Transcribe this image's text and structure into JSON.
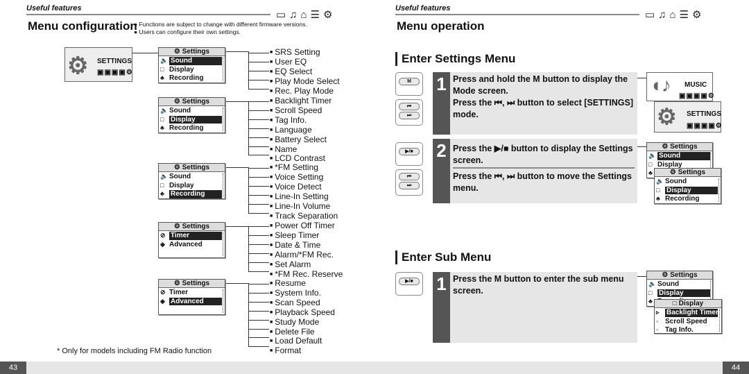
{
  "left": {
    "section": "Useful features",
    "title": "Menu configuration",
    "notes": [
      "Functions are subject to change with different firmware versions.",
      "Users can configure their own settings."
    ],
    "mode_label": "SETTINGS",
    "menus": [
      {
        "title": "Settings",
        "rows": [
          {
            "icon": "speaker",
            "label": "Sound"
          },
          {
            "icon": "display",
            "label": "Display"
          },
          {
            "icon": "mic",
            "label": "Recording"
          }
        ],
        "selected": 0,
        "items": [
          "SRS Setting",
          "User EQ",
          "EQ Select",
          "Play Mode Select",
          "Rec. Play Mode"
        ]
      },
      {
        "title": "Settings",
        "rows": [
          {
            "icon": "speaker",
            "label": "Sound"
          },
          {
            "icon": "display",
            "label": "Display"
          },
          {
            "icon": "mic",
            "label": "Recording"
          }
        ],
        "selected": 1,
        "items": [
          "Backlight Timer",
          "Scroll Speed",
          "Tag Info.",
          "Language",
          "Battery Select",
          "Name",
          "LCD Contrast"
        ]
      },
      {
        "title": "Settings",
        "rows": [
          {
            "icon": "speaker",
            "label": "Sound"
          },
          {
            "icon": "display",
            "label": "Display"
          },
          {
            "icon": "mic",
            "label": "Recording"
          }
        ],
        "selected": 2,
        "items": [
          "*FM Setting",
          "Voice Setting",
          "Voice Detect",
          "Line-In Setting",
          "Line-In Volume",
          "Track Separation"
        ]
      },
      {
        "title": "Settings",
        "rows": [
          {
            "icon": "timer",
            "label": "Timer"
          },
          {
            "icon": "advanced",
            "label": "Advanced"
          }
        ],
        "selected": 0,
        "items": [
          "Power Off Timer",
          "Sleep Timer",
          "Date & Time",
          "Alarm/*FM Rec.",
          "Set Alarm",
          "*FM Rec. Reserve"
        ]
      },
      {
        "title": "Settings",
        "rows": [
          {
            "icon": "timer",
            "label": "Timer"
          },
          {
            "icon": "advanced",
            "label": "Advanced"
          }
        ],
        "selected": 1,
        "items": [
          "Resume",
          "System Info.",
          "Scan Speed",
          "Playback Speed",
          "Study Mode",
          "Delete File",
          "Load Default",
          "Format"
        ]
      }
    ],
    "footnote": "* Only for models including FM Radio function",
    "page": "43"
  },
  "right": {
    "section": "Useful features",
    "title": "Menu operation",
    "enter_settings": "Enter Settings Menu",
    "step1_num": "1",
    "step1_a": "Press and hold the M button to display the Mode screen.",
    "step1_b": "Press the ⏮, ⏭ button to select [SETTINGS] mode.",
    "step2_num": "2",
    "step2_a": "Press the ▶/■ button to display the Settings screen.",
    "step2_b": "Press the ⏮, ⏭ button to move the Settings menu.",
    "enter_sub": "Enter Sub Menu",
    "sub1_num": "1",
    "sub1_a": "Press the M button to enter the sub menu screen.",
    "music_label": "MUSIC",
    "settings_label": "SETTINGS",
    "btn_m": "M",
    "btn_prev": "⏮",
    "btn_next": "⏭",
    "btn_play": "▶/■",
    "display_menu": {
      "title": "Display",
      "rows": [
        "Backlight Timer",
        "Scroll Speed",
        "Tag Info."
      ]
    },
    "page": "44"
  },
  "icons": [
    "folder-icon",
    "music-icon",
    "radio-icon",
    "list-icon",
    "gear-icon"
  ],
  "colors": {
    "step_bg": "#e6e6e6",
    "step_num": "#555555",
    "footer": "#e6e6e6",
    "page_box": "#555555"
  }
}
